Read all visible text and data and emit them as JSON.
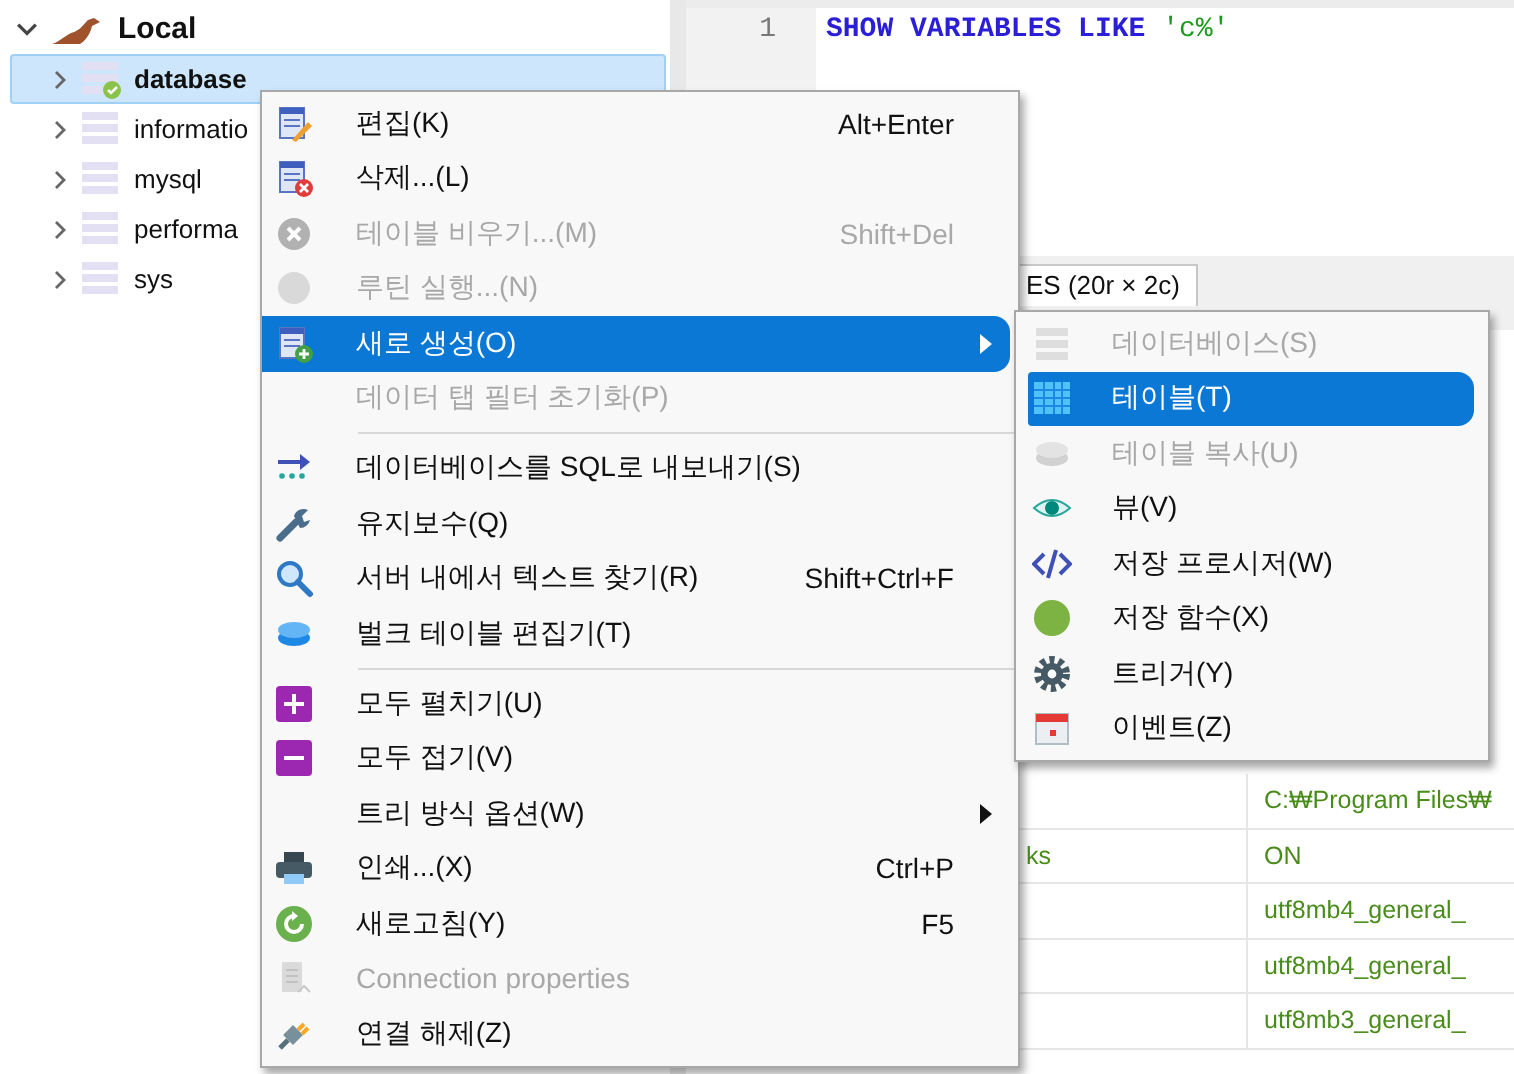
{
  "tree": {
    "root": {
      "label": "Local",
      "expanded": true,
      "children": [
        {
          "label": "database",
          "selected": true,
          "connected": true,
          "expanded": false
        },
        {
          "label": "informatio",
          "selected": false,
          "connected": false,
          "expanded": false
        },
        {
          "label": "mysql",
          "selected": false,
          "connected": false,
          "expanded": false
        },
        {
          "label": "performa",
          "selected": false,
          "connected": false,
          "expanded": false
        },
        {
          "label": "sys",
          "selected": false,
          "connected": false,
          "expanded": false
        }
      ]
    }
  },
  "editor": {
    "line_number": "1",
    "tokens": [
      {
        "text": "SHOW",
        "kind": "keyword"
      },
      {
        "text": "VARIABLES",
        "kind": "keyword"
      },
      {
        "text": "LIKE",
        "kind": "keyword"
      },
      {
        "text": "'c%'",
        "kind": "string"
      }
    ]
  },
  "result_tab": {
    "label": "ES (20r × 2c)"
  },
  "result_grid": {
    "rows": [
      {
        "column_2": "C:₩Program Files₩"
      },
      {
        "column_1": "ks",
        "column_2": "ON"
      },
      {
        "column_2": "utf8mb4_general_"
      },
      {
        "column_2": "utf8mb4_general_"
      },
      {
        "column_2": "utf8mb3_general_"
      }
    ]
  },
  "context_menu": {
    "groups": [
      [
        {
          "label": "편집(K)",
          "shortcut": "Alt+Enter",
          "disabled": false,
          "selected": false,
          "has_submenu": false
        },
        {
          "label": "삭제...(L)",
          "disabled": false,
          "selected": false,
          "has_submenu": false
        },
        {
          "label": "테이블 비우기...(M)",
          "shortcut": "Shift+Del",
          "disabled": true,
          "selected": false,
          "has_submenu": false
        },
        {
          "label": "루틴 실행...(N)",
          "disabled": true,
          "selected": false,
          "has_submenu": false
        },
        {
          "label": "새로 생성(O)",
          "disabled": false,
          "selected": true,
          "has_submenu": true
        },
        {
          "label": "데이터 탭 필터 초기화(P)",
          "disabled": true,
          "selected": false,
          "has_submenu": false
        }
      ],
      [
        {
          "label": "데이터베이스를 SQL로 내보내기(S)",
          "disabled": false,
          "selected": false,
          "has_submenu": false
        },
        {
          "label": "유지보수(Q)",
          "disabled": false,
          "selected": false,
          "has_submenu": false
        },
        {
          "label": "서버 내에서 텍스트 찾기(R)",
          "shortcut": "Shift+Ctrl+F",
          "disabled": false,
          "selected": false,
          "has_submenu": false
        },
        {
          "label": "벌크 테이블 편집기(T)",
          "disabled": false,
          "selected": false,
          "has_submenu": false
        }
      ],
      [
        {
          "label": "모두 펼치기(U)",
          "disabled": false,
          "selected": false,
          "has_submenu": false
        },
        {
          "label": "모두 접기(V)",
          "disabled": false,
          "selected": false,
          "has_submenu": false
        },
        {
          "label": "트리 방식 옵션(W)",
          "disabled": false,
          "selected": false,
          "has_submenu": true
        },
        {
          "label": "인쇄...(X)",
          "shortcut": "Ctrl+P",
          "disabled": false,
          "selected": false,
          "has_submenu": false
        },
        {
          "label": "새로고침(Y)",
          "shortcut": "F5",
          "disabled": false,
          "selected": false,
          "has_submenu": false
        },
        {
          "label": "Connection properties",
          "disabled": true,
          "selected": false,
          "has_submenu": false
        },
        {
          "label": "연결 해제(Z)",
          "disabled": false,
          "selected": false,
          "has_submenu": false
        }
      ]
    ]
  },
  "submenu": {
    "items": [
      {
        "label": "데이터베이스(S)",
        "disabled": true,
        "selected": false
      },
      {
        "label": "테이블(T)",
        "disabled": false,
        "selected": true
      },
      {
        "label": "테이블 복사(U)",
        "disabled": true,
        "selected": false
      },
      {
        "label": "뷰(V)",
        "disabled": false,
        "selected": false
      },
      {
        "label": "저장 프로시저(W)",
        "disabled": false,
        "selected": false
      },
      {
        "label": "저장 함수(X)",
        "disabled": false,
        "selected": false
      },
      {
        "label": "트리거(Y)",
        "disabled": false,
        "selected": false
      },
      {
        "label": "이벤트(Z)",
        "disabled": false,
        "selected": false
      }
    ]
  }
}
